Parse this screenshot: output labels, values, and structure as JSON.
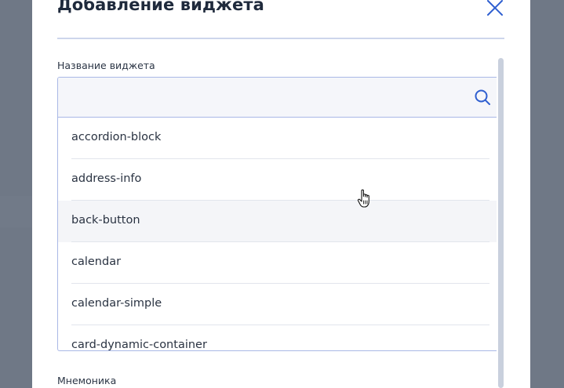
{
  "modal": {
    "title": "Добавление виджета",
    "close_icon": "close-icon"
  },
  "widget_field": {
    "label": "Название виджета",
    "search_value": "",
    "search_placeholder": "",
    "search_icon": "search-icon",
    "options": [
      "accordion-block",
      "address-info",
      "back-button",
      "calendar",
      "calendar-simple",
      "card-dynamic-container"
    ],
    "hovered_option": "back-button"
  },
  "mnemonic_field": {
    "label": "Мнемоника"
  },
  "colors": {
    "accent": "#2f5fd0",
    "border": "#a9b8e6",
    "backdrop": "#6f7886"
  }
}
